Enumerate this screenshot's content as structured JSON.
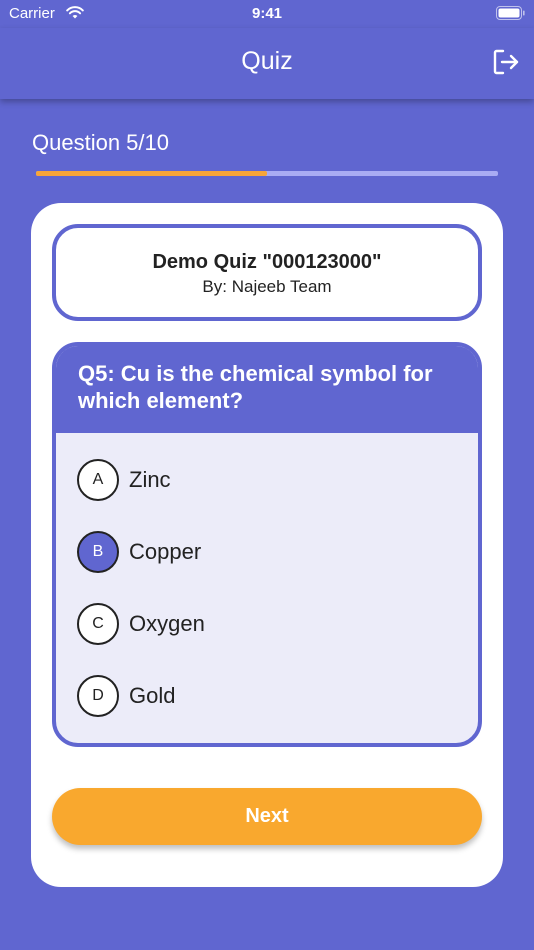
{
  "status_bar": {
    "carrier": "Carrier",
    "time": "9:41",
    "icons": [
      "wifi-icon",
      "battery-icon"
    ]
  },
  "app_bar": {
    "title": "Quiz",
    "action_icon": "logout-icon"
  },
  "progress": {
    "label": "Question 5/10",
    "current": 5,
    "total": 10,
    "fraction": 0.5
  },
  "quiz": {
    "title": "Demo Quiz \"000123000\"",
    "author": "By: Najeeb Team"
  },
  "question": {
    "text": "Q5: Cu is the chemical symbol for which element?",
    "options": [
      {
        "letter": "A",
        "label": "Zinc",
        "selected": false
      },
      {
        "letter": "B",
        "label": "Copper",
        "selected": true
      },
      {
        "letter": "C",
        "label": "Oxygen",
        "selected": false
      },
      {
        "letter": "D",
        "label": "Gold",
        "selected": false
      }
    ]
  },
  "next_label": "Next",
  "colors": {
    "primary": "#6066d0",
    "accent": "#f9a82e",
    "progress_fill": "#f7a53a",
    "progress_track": "#a9acf3",
    "options_bg": "#ececf9"
  }
}
